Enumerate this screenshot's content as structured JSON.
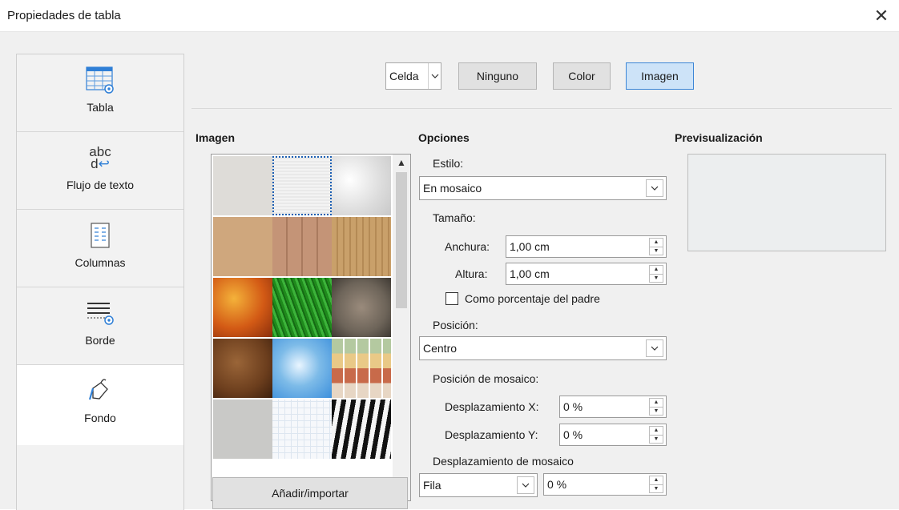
{
  "window": {
    "title": "Propiedades de tabla",
    "close_glyph": "✕"
  },
  "sidebar": {
    "items": [
      {
        "label": "Tabla",
        "icon": "table-properties-icon"
      },
      {
        "label": "Flujo de texto",
        "icon": "text-flow-icon",
        "icon_text": "abc"
      },
      {
        "label": "Columnas",
        "icon": "columns-icon"
      },
      {
        "label": "Borde",
        "icon": "borders-icon"
      },
      {
        "label": "Fondo",
        "icon": "background-fill-icon",
        "active": true
      }
    ]
  },
  "toolbar": {
    "target_value": "Celda",
    "buttons": [
      {
        "label": "Ninguno"
      },
      {
        "label": "Color"
      },
      {
        "label": "Imagen",
        "selected": true
      }
    ]
  },
  "image_section": {
    "heading": "Imagen",
    "add_button": "Añadir/importar",
    "tiles": [
      "painted-white",
      "paper-texture",
      "crumpled-paper",
      "pebbles-light",
      "wood-planks",
      "fence-wood",
      "autumn-leaves",
      "grass",
      "stone-pebbles",
      "coffee-beans",
      "sky-clouds",
      "color-mosaic",
      "concrete",
      "graph-paper",
      "zebra"
    ],
    "selected_tile": 1
  },
  "options": {
    "heading": "Opciones",
    "style_label": "Estilo:",
    "style_value": "En mosaico",
    "size_label": "Tamaño:",
    "width_label": "Anchura:",
    "width_value": "1,00 cm",
    "height_label": "Altura:",
    "height_value": "1,00 cm",
    "relative_label": "Como porcentaje del padre",
    "relative_checked": false,
    "position_label": "Posición:",
    "position_value": "Centro",
    "tile_position_label": "Posición de mosaico:",
    "x_offset_label": "Desplazamiento X:",
    "x_offset_value": "0 %",
    "y_offset_label": "Desplazamiento Y:",
    "y_offset_value": "0 %",
    "tile_offset_label": "Desplazamiento de mosaico",
    "tile_offset_mode": "Fila",
    "tile_offset_value": "0 %"
  },
  "preview": {
    "heading": "Previsualización"
  },
  "colors": {
    "selected_button_bg": "#cde3f8",
    "selected_button_border": "#3c86d6",
    "dialog_bg": "#f0f0f0"
  }
}
